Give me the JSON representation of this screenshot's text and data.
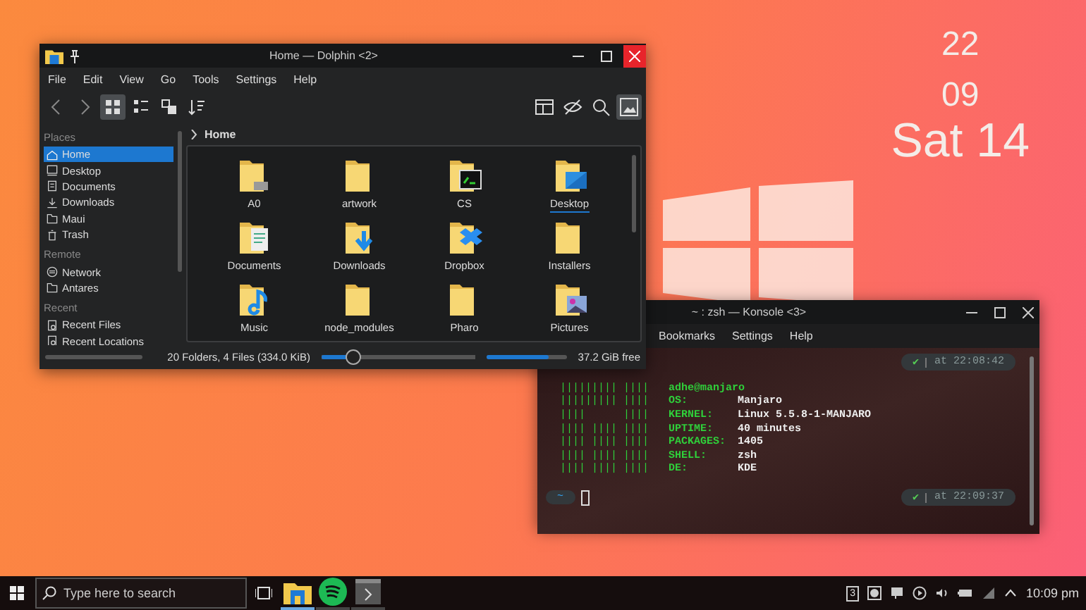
{
  "clock": {
    "hour": "22",
    "minute": "09",
    "date": "Sat 14"
  },
  "file_manager": {
    "title": "Home — Dolphin <2>",
    "menu": [
      "File",
      "Edit",
      "View",
      "Go",
      "Tools",
      "Settings",
      "Help"
    ],
    "toolbar_left": [
      {
        "kind": "back",
        "selected": false
      },
      {
        "kind": "forward",
        "selected": false
      },
      {
        "kind": "icons",
        "selected": true
      },
      {
        "kind": "compact",
        "selected": false
      },
      {
        "kind": "details",
        "selected": false
      },
      {
        "kind": "sort",
        "selected": false
      }
    ],
    "toolbar_right": [
      {
        "kind": "panel",
        "selected": false
      },
      {
        "kind": "hidden",
        "selected": false
      },
      {
        "kind": "search",
        "selected": false
      },
      {
        "kind": "preview",
        "selected": true
      }
    ],
    "places": [
      {
        "heading": "Places",
        "items": [
          {
            "label": "Home",
            "kind": "home",
            "selected": true
          },
          {
            "label": "Desktop",
            "kind": "desktop",
            "selected": false
          },
          {
            "label": "Documents",
            "kind": "documents",
            "selected": false
          },
          {
            "label": "Downloads",
            "kind": "downloads",
            "selected": false
          },
          {
            "label": "Maui",
            "kind": "folder",
            "selected": false
          },
          {
            "label": "Trash",
            "kind": "trash",
            "selected": false
          }
        ]
      },
      {
        "heading": "Remote",
        "items": [
          {
            "label": "Network",
            "kind": "network",
            "selected": false
          },
          {
            "label": "Antares",
            "kind": "folder",
            "selected": false
          }
        ]
      },
      {
        "heading": "Recent",
        "items": [
          {
            "label": "Recent Files",
            "kind": "recent",
            "selected": false
          },
          {
            "label": "Recent Locations",
            "kind": "recent",
            "selected": false
          }
        ]
      }
    ],
    "breadcrumb": "Home",
    "files": [
      {
        "name": "A0",
        "kind": "drive",
        "focused": false
      },
      {
        "name": "artwork",
        "kind": "plain",
        "focused": false
      },
      {
        "name": "CS",
        "kind": "terminal",
        "focused": false
      },
      {
        "name": "Desktop",
        "kind": "desktop",
        "focused": true
      },
      {
        "name": "Documents",
        "kind": "document",
        "focused": false
      },
      {
        "name": "Downloads",
        "kind": "download",
        "focused": false
      },
      {
        "name": "Dropbox",
        "kind": "dropbox",
        "focused": false
      },
      {
        "name": "Installers",
        "kind": "plain",
        "focused": false
      },
      {
        "name": "Music",
        "kind": "music",
        "focused": false
      },
      {
        "name": "node_modules",
        "kind": "plain",
        "focused": false
      },
      {
        "name": "Pharo",
        "kind": "plain",
        "focused": false
      },
      {
        "name": "Pictures",
        "kind": "pictures",
        "focused": false
      }
    ],
    "status": "20 Folders, 4 Files (334.0 KiB)",
    "zoom": {
      "level": 0.2
    },
    "free_space": {
      "level": 0.78,
      "label": "37.2 GiB free"
    }
  },
  "terminal": {
    "title": "~ : zsh — Konsole <3>",
    "menu": [
      "Bookmarks",
      "Settings",
      "Help"
    ],
    "first_prompt": {
      "status": "✔",
      "time": "at 22:08:42"
    },
    "lines": [
      {
        "logo": "||||||||| ||||",
        "kind": "user",
        "value": "adhe@manjaro"
      },
      {
        "logo": "||||||||| ||||",
        "kind": "field",
        "key": "OS:",
        "value": "Manjaro"
      },
      {
        "logo": "||||      ||||",
        "kind": "field",
        "key": "KERNEL:",
        "value": "Linux 5.5.8-1-MANJARO"
      },
      {
        "logo": "|||| |||| ||||",
        "kind": "field",
        "key": "UPTIME:",
        "value": "40 minutes"
      },
      {
        "logo": "|||| |||| ||||",
        "kind": "field",
        "key": "PACKAGES:",
        "value": "1405"
      },
      {
        "logo": "|||| |||| ||||",
        "kind": "field",
        "key": "SHELL:",
        "value": "zsh"
      },
      {
        "logo": "|||| |||| ||||",
        "kind": "field",
        "key": "DE:",
        "value": "KDE"
      }
    ],
    "prompt": {
      "dir": "~",
      "status": "✔",
      "time": "at 22:09:37"
    }
  },
  "taskbar": {
    "search": {
      "placeholder": "Type here to search"
    },
    "apps": [
      {
        "kind": "files",
        "active": true
      },
      {
        "kind": "music",
        "active": false
      },
      {
        "kind": "terminal",
        "active": false
      }
    ],
    "tray": {
      "badge": "3",
      "time": "10:09 pm"
    }
  }
}
